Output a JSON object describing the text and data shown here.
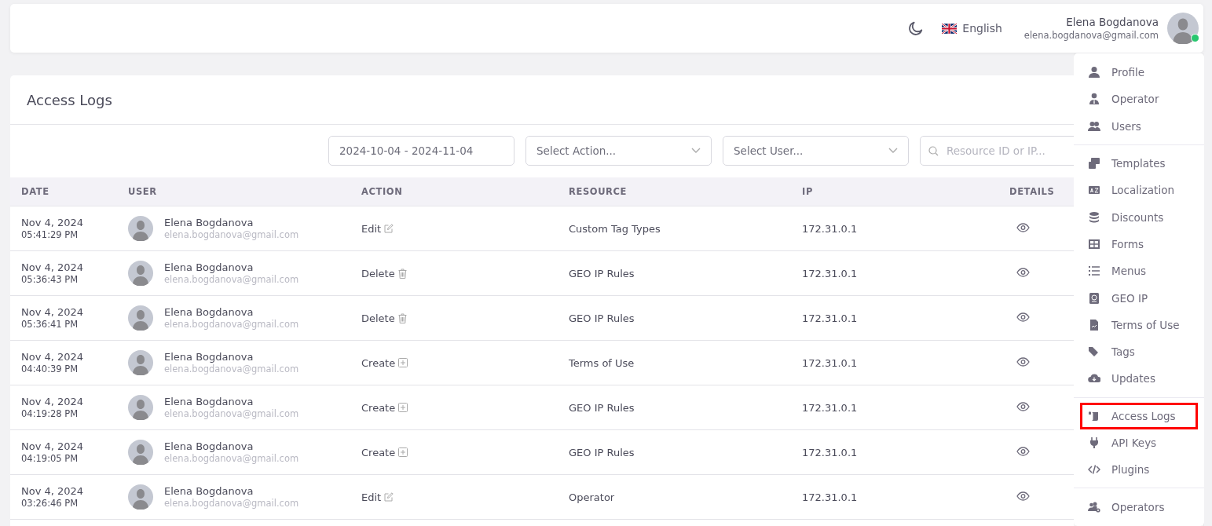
{
  "header": {
    "language": "English",
    "user": {
      "name": "Elena Bogdanova",
      "email": "elena.bogdanova@gmail.com",
      "online": true
    }
  },
  "page": {
    "title": "Access Logs"
  },
  "filters": {
    "date_range": "2024-10-04 - 2024-11-04",
    "action_select": {
      "placeholder": "Select Action..."
    },
    "user_select": {
      "placeholder": "Select User..."
    },
    "search": {
      "placeholder": "Resource ID or IP..."
    }
  },
  "table": {
    "columns": [
      "DATE",
      "USER",
      "ACTION",
      "RESOURCE",
      "IP",
      "DETAILS"
    ],
    "rows": [
      {
        "date": "Nov 4, 2024",
        "time": "05:41:29 PM",
        "user": "Elena Bogdanova",
        "email": "elena.bogdanova@gmail.com",
        "action": "Edit",
        "kind": "edit",
        "resource": "Custom Tag Types",
        "ip": "172.31.0.1"
      },
      {
        "date": "Nov 4, 2024",
        "time": "05:36:43 PM",
        "user": "Elena Bogdanova",
        "email": "elena.bogdanova@gmail.com",
        "action": "Delete",
        "kind": "delete",
        "resource": "GEO IP Rules",
        "ip": "172.31.0.1"
      },
      {
        "date": "Nov 4, 2024",
        "time": "05:36:41 PM",
        "user": "Elena Bogdanova",
        "email": "elena.bogdanova@gmail.com",
        "action": "Delete",
        "kind": "delete",
        "resource": "GEO IP Rules",
        "ip": "172.31.0.1"
      },
      {
        "date": "Nov 4, 2024",
        "time": "04:40:39 PM",
        "user": "Elena Bogdanova",
        "email": "elena.bogdanova@gmail.com",
        "action": "Create",
        "kind": "create",
        "resource": "Terms of Use",
        "ip": "172.31.0.1"
      },
      {
        "date": "Nov 4, 2024",
        "time": "04:19:28 PM",
        "user": "Elena Bogdanova",
        "email": "elena.bogdanova@gmail.com",
        "action": "Create",
        "kind": "create",
        "resource": "GEO IP Rules",
        "ip": "172.31.0.1"
      },
      {
        "date": "Nov 4, 2024",
        "time": "04:19:05 PM",
        "user": "Elena Bogdanova",
        "email": "elena.bogdanova@gmail.com",
        "action": "Create",
        "kind": "create",
        "resource": "GEO IP Rules",
        "ip": "172.31.0.1"
      },
      {
        "date": "Nov 4, 2024",
        "time": "03:26:46 PM",
        "user": "Elena Bogdanova",
        "email": "elena.bogdanova@gmail.com",
        "action": "Edit",
        "kind": "edit",
        "resource": "Operator",
        "ip": "172.31.0.1"
      }
    ]
  },
  "user_menu": {
    "groups": [
      {
        "items": [
          {
            "label": "Profile",
            "highlighted": false
          },
          {
            "label": "Operator",
            "highlighted": false
          },
          {
            "label": "Users",
            "highlighted": false
          }
        ]
      },
      {
        "items": [
          {
            "label": "Templates",
            "highlighted": false
          },
          {
            "label": "Localization",
            "highlighted": false
          },
          {
            "label": "Discounts",
            "highlighted": false
          },
          {
            "label": "Forms",
            "highlighted": false
          },
          {
            "label": "Menus",
            "highlighted": false
          },
          {
            "label": "GEO IP",
            "highlighted": false
          },
          {
            "label": "Terms of Use",
            "highlighted": false
          },
          {
            "label": "Tags",
            "highlighted": false
          },
          {
            "label": "Updates",
            "highlighted": false
          }
        ]
      },
      {
        "items": [
          {
            "label": "Access Logs",
            "highlighted": true
          },
          {
            "label": "API Keys",
            "highlighted": false
          },
          {
            "label": "Plugins",
            "highlighted": false
          }
        ]
      },
      {
        "items": [
          {
            "label": "Operators",
            "highlighted": false
          }
        ]
      }
    ]
  }
}
